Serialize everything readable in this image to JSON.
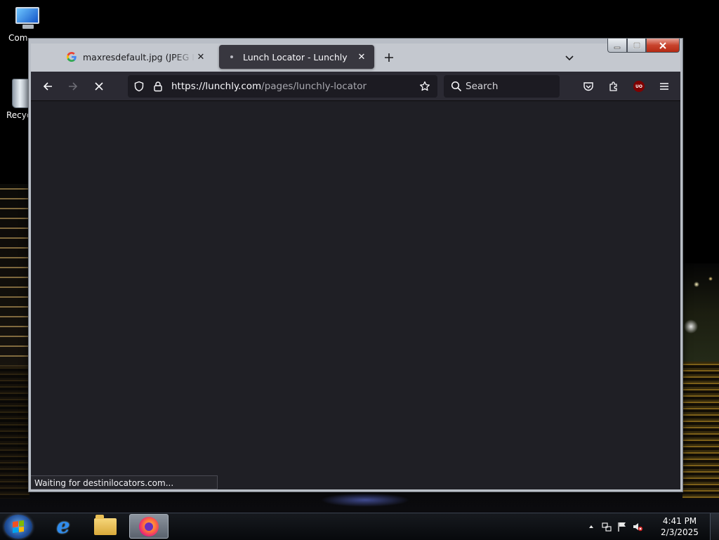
{
  "desktop": {
    "icons": [
      {
        "label": "Com",
        "icon": "computer-icon"
      },
      {
        "label": "Recyc",
        "icon": "recycle-bin-icon"
      }
    ]
  },
  "browser": {
    "tabs": [
      {
        "title": "maxresdefault.jpg (JPEG Image",
        "favicon": "google-g-icon",
        "active": false
      },
      {
        "title": "Lunch Locator - Lunchly",
        "favicon": "loading-dot-icon",
        "active": true
      }
    ],
    "url_host": "https://lunchly.com",
    "url_path": "/pages/lunchly-locator",
    "search_placeholder": "Search",
    "status_text": "Waiting for destinilocators.com...",
    "extension_badge": "UO"
  },
  "taskbar": {
    "apps": [
      "internet-explorer-icon",
      "file-explorer-icon",
      "firefox-icon"
    ],
    "active_app": "firefox-icon",
    "time": "4:41 PM",
    "date": "2/3/2025"
  },
  "colors": {
    "tab_active_bg": "#38373f",
    "toolbar_bg": "#2b2a33",
    "urlbar_bg": "#1c1b22",
    "content_bg": "#1f1f25"
  }
}
